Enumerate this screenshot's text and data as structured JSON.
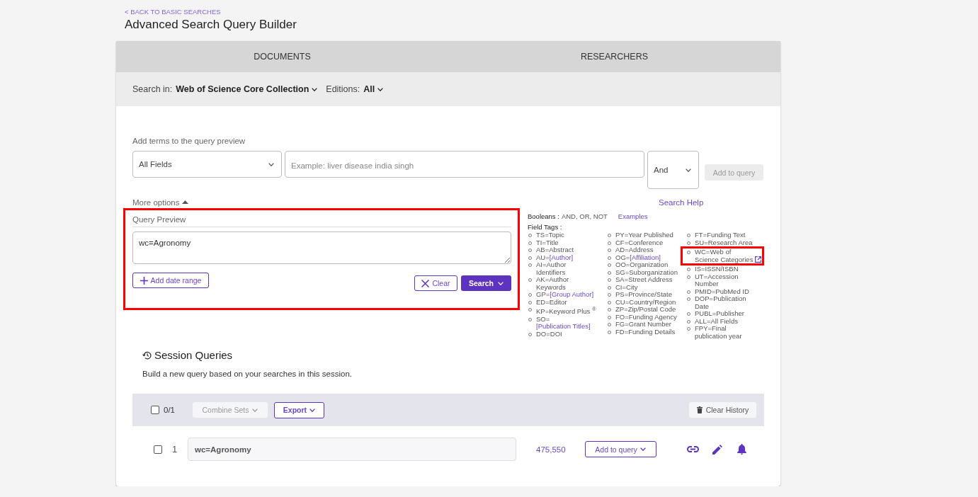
{
  "header": {
    "back_link": "< BACK TO BASIC SEARCHES",
    "title": "Advanced Search Query Builder"
  },
  "tabs": [
    {
      "label": "DOCUMENTS"
    },
    {
      "label": "RESEARCHERS"
    }
  ],
  "search_in": {
    "label": "Search in:",
    "value": "Web of Science Core Collection",
    "editions_label": "Editions:",
    "editions_value": "All"
  },
  "query_builder": {
    "label": "Add terms to the query preview",
    "field_select": "All Fields",
    "input_placeholder": "Example: liver disease india singh",
    "operator_select": "And",
    "add_button": {
      "label": "Add to query",
      "disabled": true
    }
  },
  "more_options": {
    "label": "More options",
    "expanded": true
  },
  "query_preview": {
    "title": "Query Preview",
    "highlighted": true,
    "value": "wc=Agronomy",
    "add_date_range": "Add date range",
    "clear_button": "Clear",
    "search_button": "Search"
  },
  "help": {
    "search_help": "Search Help",
    "booleans_label": "Booleans :",
    "booleans": "AND, OR, NOT",
    "examples": "Examples",
    "field_tags_label": "Field Tags :",
    "columns": [
      [
        {
          "text": "TS=Topic",
          "kind": "plain",
          "highlighted": false
        },
        {
          "text": "TI=Title",
          "kind": "plain",
          "highlighted": false
        },
        {
          "text": "AB=Abstract",
          "kind": "plain",
          "highlighted": false
        },
        {
          "text": "AU=",
          "link": "[Author]",
          "kind": "plain",
          "highlighted": false
        },
        {
          "text": "AI=Author Identifiers",
          "kind": "plain",
          "highlighted": false
        },
        {
          "text": "AK=Author Keywords",
          "kind": "plain",
          "highlighted": false
        },
        {
          "text": "GP=",
          "link": "[Group Author]",
          "kind": "plain",
          "highlighted": false
        },
        {
          "text": "ED=Editor",
          "kind": "plain",
          "highlighted": false
        },
        {
          "text": "KP=Keyword Plus $^{®}$",
          "kind": "plain",
          "highlighted": false
        },
        {
          "text": "SO=",
          "link": "[Publication Titles]",
          "kind": "plain",
          "highlighted": false
        },
        {
          "text": "DO=DOI",
          "kind": "plain",
          "highlighted": false
        }
      ],
      [
        {
          "text": "PY=Year Published",
          "kind": "plain",
          "highlighted": false
        },
        {
          "text": "CF=Conference",
          "kind": "plain",
          "highlighted": false
        },
        {
          "text": "AD=Address",
          "kind": "plain",
          "highlighted": false
        },
        {
          "text": "OG=",
          "link": "[Affiliation]",
          "kind": "plain",
          "highlighted": false
        },
        {
          "text": "OO=Organization",
          "kind": "plain",
          "highlighted": false
        },
        {
          "text": "SG=Suborganization",
          "kind": "plain",
          "highlighted": false
        },
        {
          "text": "SA=Street Address",
          "kind": "plain",
          "highlighted": false
        },
        {
          "text": "CI=City",
          "kind": "plain",
          "highlighted": false
        },
        {
          "text": "PS=Province/State",
          "kind": "plain",
          "highlighted": false
        },
        {
          "text": "CU=Country/Region",
          "kind": "plain",
          "highlighted": false
        },
        {
          "text": "ZP=Zip/Postal Code",
          "kind": "plain",
          "highlighted": false
        },
        {
          "text": "FO=Funding Agency",
          "kind": "plain",
          "highlighted": false
        },
        {
          "text": "FG=Grant Number",
          "kind": "plain",
          "highlighted": false
        },
        {
          "text": "FD=Funding Details",
          "kind": "plain",
          "highlighted": false
        }
      ],
      [
        {
          "text": "FT=Funding Text",
          "kind": "plain",
          "highlighted": false
        },
        {
          "text": "SU=Research Area",
          "kind": "plain",
          "highlighted": false
        },
        {
          "text": "WC=Web of Science Categories",
          "kind": "external",
          "highlighted": true
        },
        {
          "text": "IS=ISSN/ISBN",
          "kind": "plain",
          "highlighted": false
        },
        {
          "text": "UT=Accession Number",
          "kind": "plain",
          "highlighted": false
        },
        {
          "text": "PMID=PubMed ID",
          "kind": "plain",
          "highlighted": false
        },
        {
          "text": "DOP=Publication Date",
          "kind": "plain",
          "highlighted": false
        },
        {
          "text": "PUBL=Publisher",
          "kind": "plain",
          "highlighted": false
        },
        {
          "text": "ALL=All Fields",
          "kind": "plain",
          "highlighted": false
        },
        {
          "text": "FPY=Final publication year",
          "kind": "plain",
          "highlighted": false
        }
      ]
    ]
  },
  "session": {
    "title": "Session Queries",
    "description": "Build a new query based on your searches in this session.",
    "toolbar": {
      "select_all": {
        "checked": false,
        "count": "0/1"
      },
      "combine_sets": {
        "label": "Combine Sets",
        "disabled": true
      },
      "export": "Export",
      "clear_history": "Clear History"
    },
    "rows": [
      {
        "checked": false,
        "number": "1",
        "query": "wc=Agronomy",
        "results": "475,550",
        "add_button": "Add to query"
      }
    ]
  }
}
